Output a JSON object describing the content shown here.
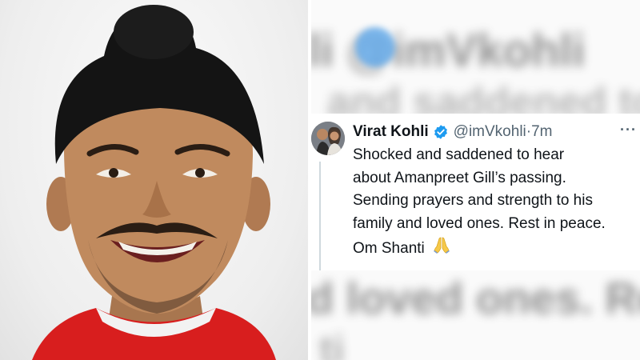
{
  "blur_background": {
    "top_line_1": "li @imVkohli",
    "top_line_2": "and saddened to",
    "bottom_line_1": "d loved ones. Re",
    "bottom_line_2": "ti"
  },
  "tweet": {
    "author_name": "Virat Kohli",
    "verified": true,
    "handle": "@imVkohli",
    "separator": " · ",
    "time_ago": "7m",
    "more_icon": "···",
    "lines": [
      "Shocked and saddened to hear",
      "about Amanpreet Gill’s passing.",
      "Sending prayers and strength to his",
      "family and loved ones. Rest in peace.",
      "Om Shanti"
    ],
    "emoji": "folded-hands-icon",
    "colors": {
      "verified_blue": "#1d9bf0",
      "text": "#0f1419",
      "secondary_text": "#536471",
      "jersey_red": "#d81e1e"
    }
  }
}
